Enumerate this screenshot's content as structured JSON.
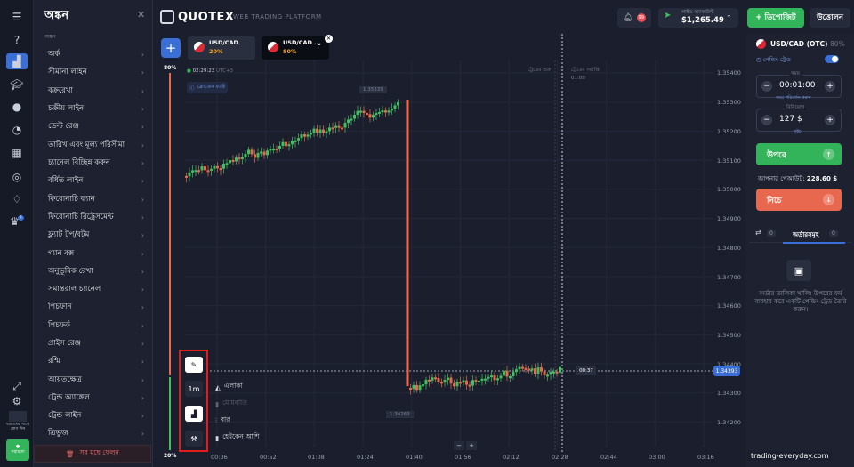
{
  "rail": {
    "badge_count": "4",
    "flag_label": "আমাদের সাথে যোগ দিন",
    "support_label": "সহায়তা"
  },
  "panel": {
    "title": "অঙ্কন",
    "subtitle": "অঙ্কন",
    "items": [
      {
        "label": "অর্ক"
      },
      {
        "label": "সীমানা লাইন"
      },
      {
        "label": "বক্ররেখা"
      },
      {
        "label": "চক্রীয় লাইন"
      },
      {
        "label": "ডেল্ট রেঞ্জ"
      },
      {
        "label": "তারিখ এবং মূল্য পরিসীমা"
      },
      {
        "label": "চ্যানেল বিচ্ছিন্ন করুন"
      },
      {
        "label": "বর্ধিত লাইন"
      },
      {
        "label": "ফিবোনাচি ফ্যান"
      },
      {
        "label": "ফিবোনাচি রিট্রেসমেন্ট"
      },
      {
        "label": "ফ্ল্যাট টপ/বটম"
      },
      {
        "label": "গ্যান বক্স"
      },
      {
        "label": "অনুভূমিক রেখা"
      },
      {
        "label": "সমান্তরাল চ্যানেল"
      },
      {
        "label": "পিচফান"
      },
      {
        "label": "পিচফর্ক"
      },
      {
        "label": "প্রাইস রেঞ্জ"
      },
      {
        "label": "রশ্মি"
      },
      {
        "label": "আয়তক্ষেত্র"
      },
      {
        "label": "ট্রেন্ড অ্যাঙ্গেল"
      },
      {
        "label": "ট্রেন্ড লাইন"
      },
      {
        "label": "ত্রিভুজ"
      }
    ],
    "delete_all": "সব মুছে ফেলুন"
  },
  "header": {
    "logo": "QUOTEX",
    "logo_sub": "WEB TRADING PLATFORM",
    "notif_count": "99",
    "account_type": "লাইভ অ্যাকাউন্ট",
    "balance": "$1,265.49",
    "deposit": "ডিপোজিট",
    "withdraw": "উত্তোলন"
  },
  "assets": [
    {
      "name": "USD/CAD",
      "payout": "20%"
    },
    {
      "name": "USD/CAD ...",
      "payout": "80%"
    }
  ],
  "chart": {
    "top_pct": "80%",
    "bottom_pct": "20%",
    "clock": "02:29:23",
    "tz": "UTC+3",
    "ftt_label": "ফ্রোজেন ফ্যাক্ট",
    "trade_start": "ট্রেডের শুরু",
    "trade_end": "ট্রেডের সমাপ্তি",
    "trade_end_time": "01:00",
    "hi_label": "1.35335",
    "lo_label": "1.34263",
    "current_price": "1.34393",
    "timer": "00:37",
    "prices": [
      "1.35400",
      "1.35300",
      "1.35200",
      "1.35100",
      "1.35000",
      "1.34900",
      "1.34800",
      "1.34700",
      "1.34600",
      "1.34500",
      "1.34400",
      "1.34300",
      "1.34200"
    ],
    "times": [
      "00:36",
      "00:52",
      "01:08",
      "01:24",
      "01:40",
      "01:56",
      "02:12",
      "02:28",
      "02:44",
      "03:00",
      "03:16"
    ],
    "timeframe": "1m",
    "chart_types": [
      {
        "label": "এলাকা",
        "active": true
      },
      {
        "label": "মোমবাতি",
        "active": false
      },
      {
        "label": "বার",
        "active": true
      },
      {
        "label": "হেইকেন আশি",
        "active": true
      }
    ],
    "zoom_minus": "−",
    "zoom_plus": "+"
  },
  "right": {
    "pair": "USD/CAD (OTC)",
    "payout": "80%",
    "pending": "পেন্ডিং ট্রেড",
    "time_label": "সময়",
    "time_value": "00:01:00",
    "time_hint": "সময় পরিবর্তন করুন",
    "amount_label": "বিনিয়োগ",
    "amount_value": "127 $",
    "amount_hint": "সুইচ",
    "up": "উপরে",
    "down": "নিচে",
    "payout_label": "আপনার পেআউট:",
    "payout_value": "228.60 $",
    "orders_title": "অর্ডারসমূহ",
    "trades_count": "0",
    "orders_count": "0",
    "empty_text": "অর্ডার তালিকা খালি। উপরের ফর্ম ব্যবহার করে একটি পেন্ডিং ট্রেড তৈরি করুন।"
  },
  "watermark": "trading-everyday.com"
}
